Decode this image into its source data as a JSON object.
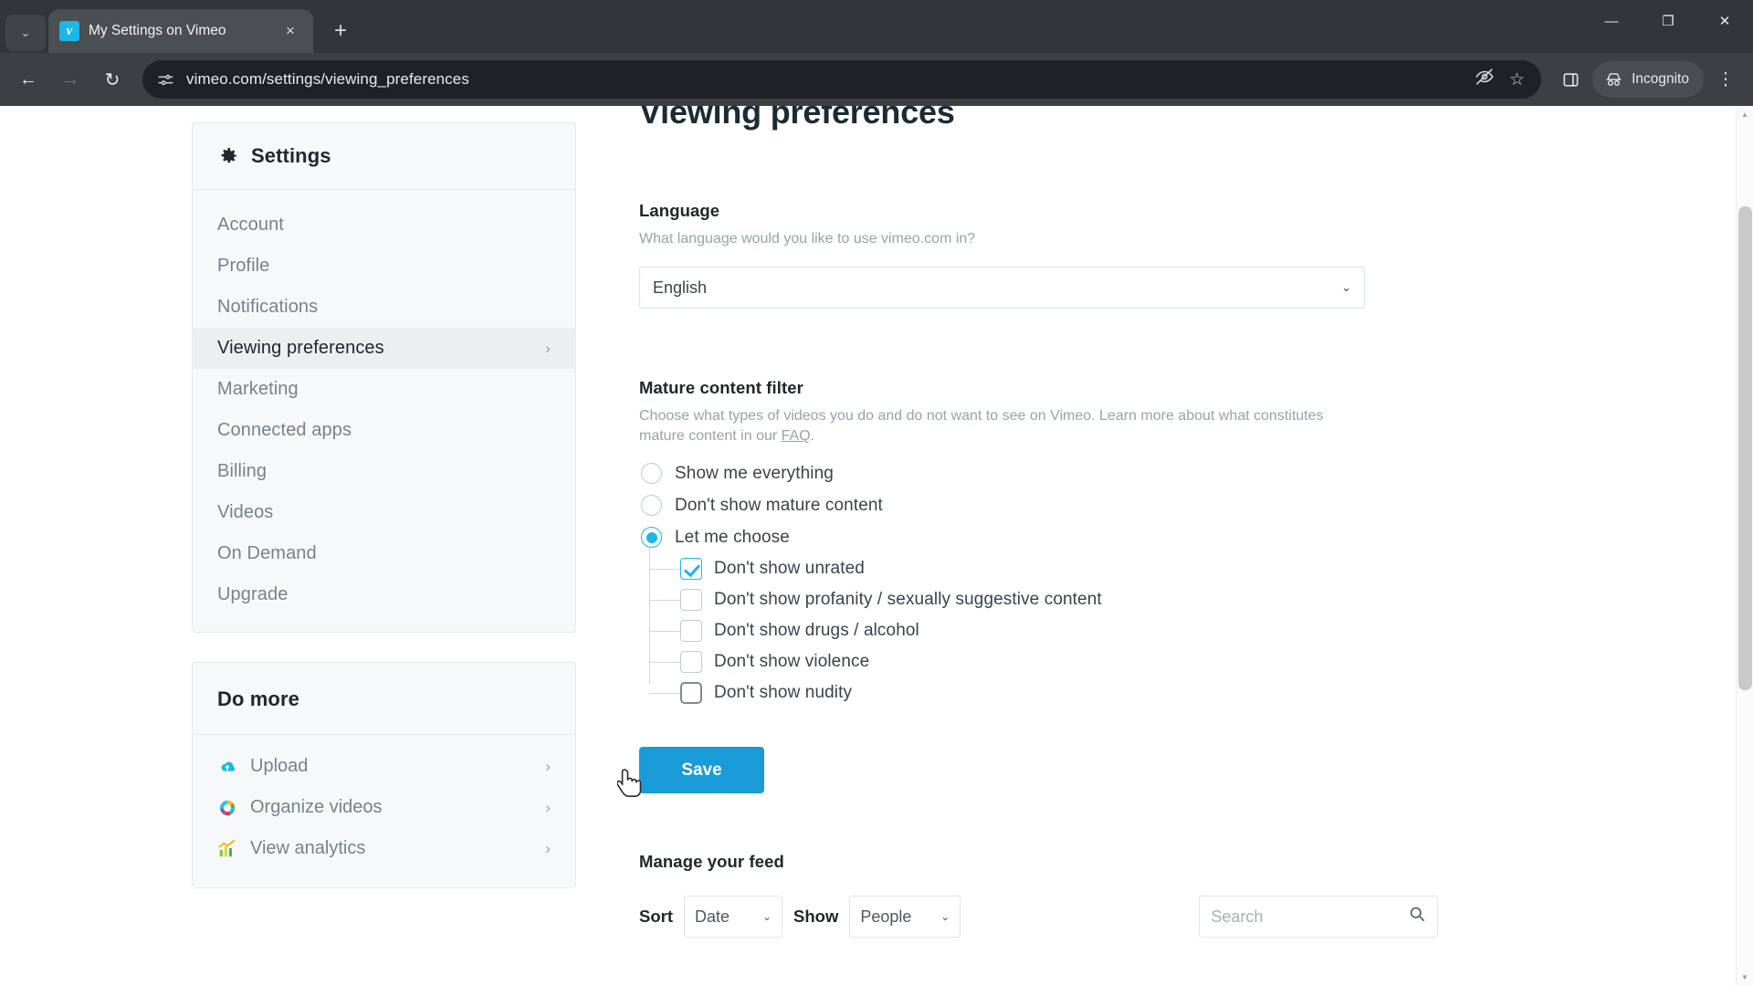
{
  "browser": {
    "tab": {
      "title": "My Settings on Vimeo",
      "favicon_letter": "v",
      "close_label": "×"
    },
    "tab_list_icon": "⌄",
    "new_tab_label": "+",
    "window_controls": {
      "minimize": "—",
      "maximize": "❐",
      "close": "✕"
    },
    "nav": {
      "back": "←",
      "forward": "→",
      "reload": "↻"
    },
    "omnibox": {
      "url": "vimeo.com/settings/viewing_preferences",
      "site_info_icon": "tune-icon"
    },
    "toolbar_right": {
      "tracking_protection": "👁",
      "bookmark": "☆",
      "side_panel": "▧",
      "incognito_label": "Incognito",
      "menu": "⋮"
    }
  },
  "sidebar": {
    "title": "Settings",
    "items": [
      {
        "label": "Account",
        "active": false,
        "chevron": ""
      },
      {
        "label": "Profile",
        "active": false,
        "chevron": ""
      },
      {
        "label": "Notifications",
        "active": false,
        "chevron": ""
      },
      {
        "label": "Viewing preferences",
        "active": true,
        "chevron": "›"
      },
      {
        "label": "Marketing",
        "active": false,
        "chevron": ""
      },
      {
        "label": "Connected apps",
        "active": false,
        "chevron": ""
      },
      {
        "label": "Billing",
        "active": false,
        "chevron": ""
      },
      {
        "label": "Videos",
        "active": false,
        "chevron": ""
      },
      {
        "label": "On Demand",
        "active": false,
        "chevron": ""
      },
      {
        "label": "Upgrade",
        "active": false,
        "chevron": ""
      }
    ]
  },
  "do_more": {
    "title": "Do more",
    "items": [
      {
        "label": "Upload",
        "icon": "cloud-upload-icon",
        "chevron": "›"
      },
      {
        "label": "Organize videos",
        "icon": "organize-videos-icon",
        "chevron": "›"
      },
      {
        "label": "View analytics",
        "icon": "analytics-chart-icon",
        "chevron": "›"
      }
    ]
  },
  "main": {
    "title": "Viewing preferences",
    "language": {
      "label": "Language",
      "description": "What language would you like to use vimeo.com in?",
      "selected": "English",
      "arrow": "⌄"
    },
    "mature_filter": {
      "label": "Mature content filter",
      "description_before": "Choose what types of videos you do and do not want to see on Vimeo. Learn more about what constitutes mature content in our ",
      "description_link": "FAQ",
      "description_after": ".",
      "radios": [
        {
          "label": "Show me everything",
          "checked": false
        },
        {
          "label": "Don't show mature content",
          "checked": false
        },
        {
          "label": "Let me choose",
          "checked": true
        }
      ],
      "checkboxes": [
        {
          "label": "Don't show unrated",
          "checked": true,
          "focused": false
        },
        {
          "label": "Don't show profanity / sexually suggestive content",
          "checked": false,
          "focused": false
        },
        {
          "label": "Don't show drugs / alcohol",
          "checked": false,
          "focused": false
        },
        {
          "label": "Don't show violence",
          "checked": false,
          "focused": false
        },
        {
          "label": "Don't show nudity",
          "checked": false,
          "focused": true
        }
      ]
    },
    "save_label": "Save",
    "feed": {
      "title": "Manage your feed",
      "sort_label": "Sort",
      "sort_value": "Date",
      "show_label": "Show",
      "show_value": "People",
      "search_placeholder": "Search",
      "arrow": "⌄"
    }
  },
  "colors": {
    "accent": "#1ab7ea",
    "save_button": "#199bd7",
    "chrome_tabstrip": "#323639",
    "chrome_toolbar": "#3c4043",
    "omnibox": "#202124",
    "card_bg": "#f7f8f9",
    "text_dark": "#22272b",
    "text_muted": "#9aa3a9"
  }
}
